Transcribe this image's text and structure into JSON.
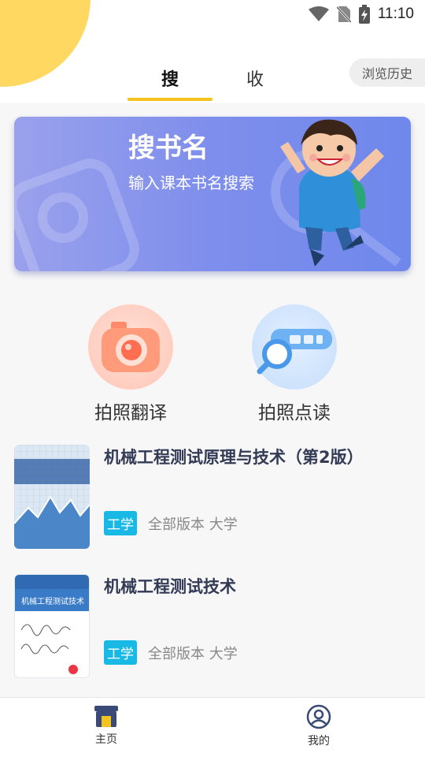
{
  "status_bar": {
    "time": "11:10",
    "icons": [
      "wifi-icon",
      "no-sim-icon",
      "battery-charging-icon"
    ]
  },
  "tabs": [
    {
      "label": "搜",
      "active": true
    },
    {
      "label": "收",
      "active": false
    }
  ],
  "history_button": {
    "label": "浏览历史"
  },
  "banner": {
    "title": "搜书名",
    "subtitle": "输入课本书名搜索"
  },
  "actions": [
    {
      "label": "拍照翻译",
      "icon": "camera-icon"
    },
    {
      "label": "拍照点读",
      "icon": "scan-read-icon"
    }
  ],
  "books": [
    {
      "title": "机械工程测试原理与技术（第2版）",
      "tag": "工学",
      "meta": "全部版本 大学"
    },
    {
      "title": "机械工程测试技术",
      "tag": "工学",
      "meta": "全部版本 大学",
      "cover_text": "机械工程测试技术"
    }
  ],
  "bottom_nav": [
    {
      "label": "主页",
      "icon": "home-store-icon"
    },
    {
      "label": "我的",
      "icon": "user-profile-icon"
    }
  ],
  "colors": {
    "accent": "#f6c21c",
    "banner": "#7e8eec",
    "tag": "#19b9e6"
  }
}
